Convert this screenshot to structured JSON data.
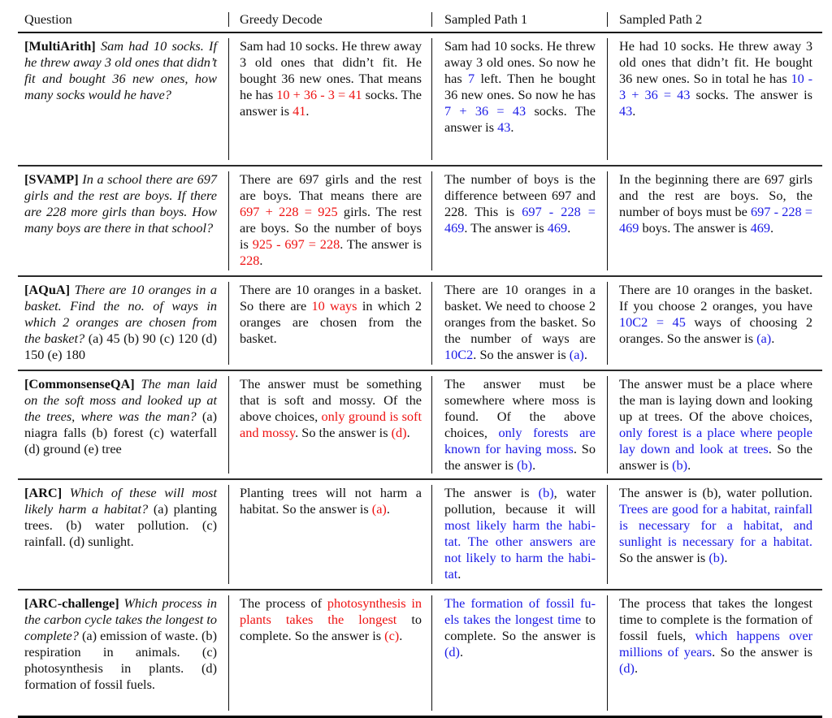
{
  "header": {
    "columns": [
      "Question",
      "Greedy Decode",
      "Sampled Path 1",
      "Sampled Path 2"
    ]
  },
  "colors": {
    "incorrect": "#ee1111",
    "correct": "#1a1ae6",
    "text": "#111111"
  },
  "rows": [
    {
      "dataset": "[MultiArith]",
      "question": [
        {
          "t": "Sam had 10 socks. If he threw away 3 old ones that didn’t fit and bought 36 new ones, how many socks would he have?",
          "s": "q"
        }
      ],
      "greedy": [
        {
          "t": "Sam had 10 socks.  He threw away 3 old ones that didn’t fit. He bought 36 new ones.  That means he has ",
          "s": "plain"
        },
        {
          "t": "10 + 36 - 3 = 41",
          "s": "red"
        },
        {
          "t": " socks. The answer is ",
          "s": "plain"
        },
        {
          "t": "41",
          "s": "red"
        },
        {
          "t": ".",
          "s": "plain"
        }
      ],
      "path1": [
        {
          "t": "Sam had 10 socks.  He threw away 3 old ones. So now he has ",
          "s": "plain"
        },
        {
          "t": "7",
          "s": "blue"
        },
        {
          "t": " left. Then he bought 36 new ones.  So now he has ",
          "s": "plain"
        },
        {
          "t": "7 + 36 = 43",
          "s": "blue"
        },
        {
          "t": " socks. The answer is ",
          "s": "plain"
        },
        {
          "t": "43",
          "s": "blue"
        },
        {
          "t": ".",
          "s": "plain"
        }
      ],
      "path2": [
        {
          "t": "He had 10 socks. He threw away 3 old ones that didn’t fit.  He bought 36 new ones.  So in total he has ",
          "s": "plain"
        },
        {
          "t": "10 - 3 + 36 = 43",
          "s": "blue"
        },
        {
          "t": " socks. The answer is ",
          "s": "plain"
        },
        {
          "t": "43",
          "s": "blue"
        },
        {
          "t": ".",
          "s": "plain"
        }
      ]
    },
    {
      "dataset": "[SVAMP]",
      "question": [
        {
          "t": "In a school there are 697 girls and the rest are boys. If there are 228 more girls than boys. How many boys are there in that school?",
          "s": "q"
        }
      ],
      "greedy": [
        {
          "t": "There are 697 girls and the rest are boys.  That means there are ",
          "s": "plain"
        },
        {
          "t": "697 + 228 = 925",
          "s": "red"
        },
        {
          "t": " girls.  The rest are boys. So the number of boys is ",
          "s": "plain"
        },
        {
          "t": "925 - 697 = 228",
          "s": "red"
        },
        {
          "t": ".  The answer is ",
          "s": "plain"
        },
        {
          "t": "228",
          "s": "red"
        },
        {
          "t": ".",
          "s": "plain"
        }
      ],
      "path1": [
        {
          "t": "The number of boys is the difference between 697 and 228. This is ",
          "s": "plain"
        },
        {
          "t": "697 - 228 = 469",
          "s": "blue"
        },
        {
          "t": ". The answer is ",
          "s": "plain"
        },
        {
          "t": "469",
          "s": "blue"
        },
        {
          "t": ".",
          "s": "plain"
        }
      ],
      "path2": [
        {
          "t": "In the beginning there are 697 girls and the rest are boys. So, the number of boys must be ",
          "s": "plain"
        },
        {
          "t": "697 - 228 = 469",
          "s": "blue"
        },
        {
          "t": " boys. The answer is ",
          "s": "plain"
        },
        {
          "t": "469",
          "s": "blue"
        },
        {
          "t": ".",
          "s": "plain"
        }
      ]
    },
    {
      "dataset": "[AQuA]",
      "question": [
        {
          "t": "There are 10 oranges in a basket. Find the no. of ways in which 2 oranges are chosen from the basket?",
          "s": "q"
        },
        {
          "t": " (a) 45 (b) 90 (c) 120 (d) 150 (e) 180",
          "s": "plain"
        }
      ],
      "greedy": [
        {
          "t": "There are 10 oranges in a bas­ket.  So there are ",
          "s": "plain"
        },
        {
          "t": "10 ways",
          "s": "red"
        },
        {
          "t": " in which 2 oranges are chosen from the basket.",
          "s": "plain"
        }
      ],
      "path1": [
        {
          "t": "There are 10 oranges in a basket. We need to choose 2 oranges from the basket. So the number of ways are ",
          "s": "plain"
        },
        {
          "t": "10C2",
          "s": "blue"
        },
        {
          "t": ". So the answer is ",
          "s": "plain"
        },
        {
          "t": "(a)",
          "s": "blue"
        },
        {
          "t": ".",
          "s": "plain"
        }
      ],
      "path2": [
        {
          "t": "There are 10 oranges in the bas­ket. If you choose 2 oranges, you have ",
          "s": "plain"
        },
        {
          "t": "10C2 = 45",
          "s": "blue"
        },
        {
          "t": " ways of choosing 2 oranges. So the answer is ",
          "s": "plain"
        },
        {
          "t": "(a)",
          "s": "blue"
        },
        {
          "t": ".",
          "s": "plain"
        }
      ]
    },
    {
      "dataset": "[CommonsenseQA]",
      "question": [
        {
          "t": "The man laid on the soft moss and looked up at the trees, where was the man?",
          "s": "q"
        },
        {
          "t": " (a) niagra falls (b) forest (c) waterfall (d) ground (e) tree",
          "s": "plain"
        }
      ],
      "greedy": [
        {
          "t": "The answer must be something that is soft and mossy.  Of the above choices, ",
          "s": "plain"
        },
        {
          "t": "only ground is soft and mossy",
          "s": "red"
        },
        {
          "t": ".  So the answer is ",
          "s": "plain"
        },
        {
          "t": "(d)",
          "s": "red"
        },
        {
          "t": ".",
          "s": "plain"
        }
      ],
      "path1": [
        {
          "t": "The answer must be somewhere where moss is found.  Of the above choices, ",
          "s": "plain"
        },
        {
          "t": "only forests are known for having moss",
          "s": "blue"
        },
        {
          "t": ". So the answer is ",
          "s": "plain"
        },
        {
          "t": "(b)",
          "s": "blue"
        },
        {
          "t": ".",
          "s": "plain"
        }
      ],
      "path2": [
        {
          "t": "The answer must be a place where the man is laying down and look­ing up at trees.  Of the above choices, ",
          "s": "plain"
        },
        {
          "t": "only forest is a place where people lay down and look at trees",
          "s": "blue"
        },
        {
          "t": ". So the answer is ",
          "s": "plain"
        },
        {
          "t": "(b)",
          "s": "blue"
        },
        {
          "t": ".",
          "s": "plain"
        }
      ]
    },
    {
      "dataset": "[ARC]",
      "question": [
        {
          "t": "Which of these will most likely harm a habitat?",
          "s": "q"
        },
        {
          "t": " (a) plant­ing trees. (b) water pollution. (c) rainfall. (d) sunlight.",
          "s": "plain"
        }
      ],
      "greedy": [
        {
          "t": "Planting trees will not harm a habitat. So the answer is ",
          "s": "plain"
        },
        {
          "t": "(a)",
          "s": "red"
        },
        {
          "t": ".",
          "s": "plain"
        }
      ],
      "path1": [
        {
          "t": "The answer is ",
          "s": "plain"
        },
        {
          "t": "(b)",
          "s": "blue"
        },
        {
          "t": ", water pollution, because it will ",
          "s": "plain"
        },
        {
          "t": "most likely harm the habi­tat. The other answers are not likely to harm the habi­tat",
          "s": "blue"
        },
        {
          "t": ".",
          "s": "plain"
        }
      ],
      "path2": [
        {
          "t": "The answer is (b), water pollution. ",
          "s": "plain"
        },
        {
          "t": "Trees are good for a habitat, rain­fall is necessary for a habitat, and sunlight is necessary for a habitat.",
          "s": "blue"
        },
        {
          "t": " So the answer is ",
          "s": "plain"
        },
        {
          "t": "(b)",
          "s": "blue"
        },
        {
          "t": ".",
          "s": "plain"
        }
      ]
    },
    {
      "dataset": "[ARC-challenge]",
      "question": [
        {
          "t": "Which pro­cess in the carbon cycle takes the longest to complete?",
          "s": "q"
        },
        {
          "t": "  (a) emis­sion of waste.  (b) respiration in animals.  (c) photosynthesis in plants. (d) formation of fossil fu­els.",
          "s": "plain"
        }
      ],
      "greedy": [
        {
          "t": "The process of ",
          "s": "plain"
        },
        {
          "t": "photosynthesis in plants takes the longest",
          "s": "red"
        },
        {
          "t": " to complete. So the answer is ",
          "s": "plain"
        },
        {
          "t": "(c)",
          "s": "red"
        },
        {
          "t": ".",
          "s": "plain"
        }
      ],
      "path1": [
        {
          "t": "The formation of fossil fu­els takes the longest time",
          "s": "blue"
        },
        {
          "t": " to complete.  So the an­swer is ",
          "s": "plain"
        },
        {
          "t": "(d)",
          "s": "blue"
        },
        {
          "t": ".",
          "s": "plain"
        }
      ],
      "path2": [
        {
          "t": "The process that takes the longest time to complete is the forma­tion of fossil fuels, ",
          "s": "plain"
        },
        {
          "t": "which hap­pens over millions of years",
          "s": "blue"
        },
        {
          "t": ".  So the answer is ",
          "s": "plain"
        },
        {
          "t": "(d)",
          "s": "blue"
        },
        {
          "t": ".",
          "s": "plain"
        }
      ]
    }
  ]
}
